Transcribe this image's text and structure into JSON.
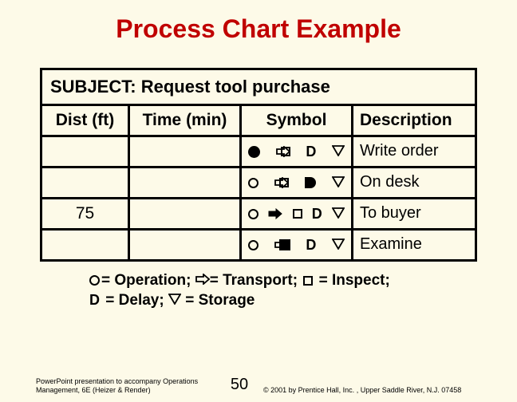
{
  "title": "Process Chart Example",
  "subject_label": "SUBJECT:",
  "subject_text": "Request tool purchase",
  "headers": {
    "dist": "Dist (ft)",
    "time": "Time (min)",
    "symbol": "Symbol",
    "desc": "Description"
  },
  "rows": [
    {
      "dist": "",
      "time": "",
      "desc": "Write order",
      "active": "operation"
    },
    {
      "dist": "",
      "time": "",
      "desc": "On desk",
      "active": "delay"
    },
    {
      "dist": "75",
      "time": "",
      "desc": "To buyer",
      "active": "transport"
    },
    {
      "dist": "",
      "time": "",
      "desc": "Examine",
      "active": "inspect"
    }
  ],
  "legend": {
    "operation": "= Operation;",
    "transport": "= Transport;",
    "inspect": " = Inspect;",
    "delay": " = Delay;",
    "storage": " = Storage"
  },
  "footer": {
    "credit": "PowerPoint presentation to accompany Operations Management, 6E (Heizer & Render)",
    "page": "50",
    "copyright": "© 2001 by Prentice Hall, Inc. , Upper Saddle River, N.J. 07458"
  },
  "chart_data": {
    "type": "table",
    "title": "Process Chart Example",
    "subject": "Request tool purchase",
    "columns": [
      "Dist (ft)",
      "Time (min)",
      "Symbol",
      "Description"
    ],
    "symbol_legend": {
      "O": "Operation",
      "arrow": "Transport",
      "square": "Inspect",
      "D": "Delay",
      "triangle": "Storage"
    },
    "rows": [
      {
        "dist_ft": null,
        "time_min": null,
        "symbol": "Operation",
        "description": "Write order"
      },
      {
        "dist_ft": null,
        "time_min": null,
        "symbol": "Delay",
        "description": "On desk"
      },
      {
        "dist_ft": 75,
        "time_min": null,
        "symbol": "Transport",
        "description": "To buyer"
      },
      {
        "dist_ft": null,
        "time_min": null,
        "symbol": "Inspect",
        "description": "Examine"
      }
    ]
  }
}
